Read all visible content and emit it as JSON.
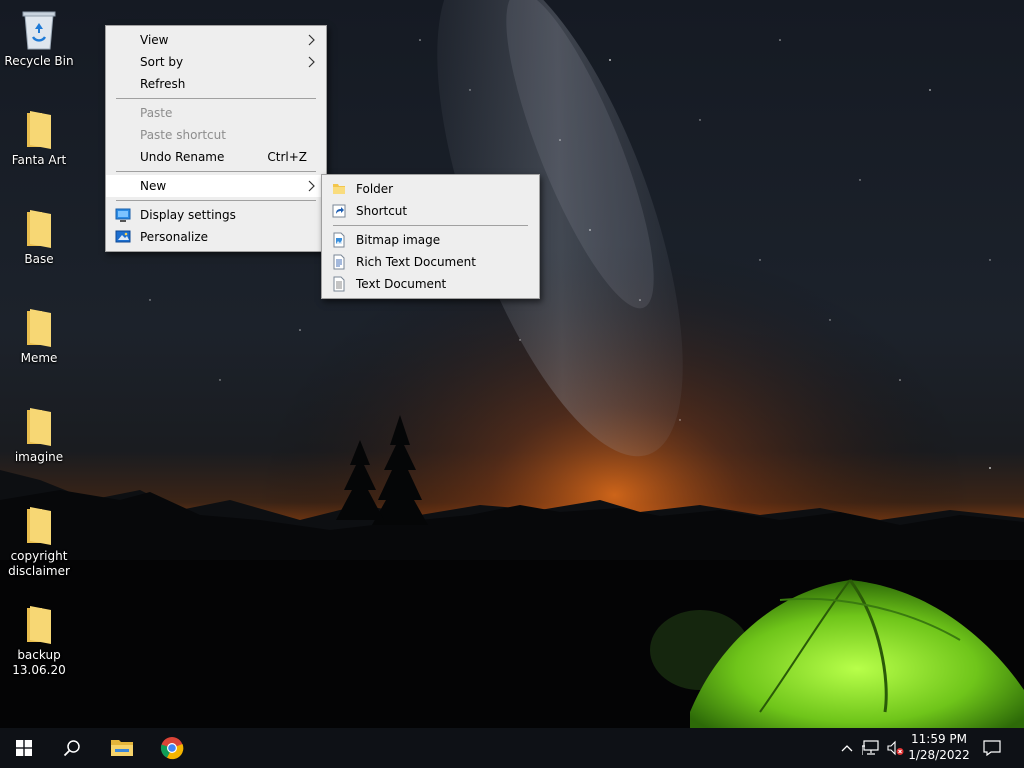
{
  "desktop": {
    "icons": [
      {
        "label": "Recycle Bin",
        "icon": "recycle-bin-icon"
      },
      {
        "label": "Fanta Art",
        "icon": "folder-icon"
      },
      {
        "label": "Base",
        "icon": "folder-icon"
      },
      {
        "label": "Meme",
        "icon": "folder-icon"
      },
      {
        "label": "imagine",
        "icon": "folder-icon"
      },
      {
        "label": "copyright disclaimer",
        "icon": "folder-icon"
      },
      {
        "label": "backup 13.06.20",
        "icon": "folder-icon"
      }
    ]
  },
  "context_menu": {
    "items": [
      {
        "label": "View",
        "has_submenu": true
      },
      {
        "label": "Sort by",
        "has_submenu": true
      },
      {
        "label": "Refresh"
      },
      {
        "label": "Paste",
        "disabled": true
      },
      {
        "label": "Paste shortcut",
        "disabled": true
      },
      {
        "label": "Undo Rename",
        "shortcut": "Ctrl+Z"
      },
      {
        "label": "New",
        "has_submenu": true,
        "highlighted": true
      },
      {
        "label": "Display settings",
        "icon": "display-settings-icon"
      },
      {
        "label": "Personalize",
        "icon": "personalize-icon"
      }
    ]
  },
  "new_submenu": {
    "items": [
      {
        "label": "Folder",
        "icon": "folder-icon"
      },
      {
        "label": "Shortcut",
        "icon": "shortcut-icon"
      },
      {
        "label": "Bitmap image",
        "icon": "bitmap-image-icon"
      },
      {
        "label": "Rich Text Document",
        "icon": "rich-text-document-icon"
      },
      {
        "label": "Text Document",
        "icon": "text-document-icon"
      }
    ]
  },
  "taskbar": {
    "pinned": [
      "start-icon",
      "search-icon",
      "file-explorer-icon",
      "chrome-icon"
    ],
    "tray": [
      "chevron-up-icon",
      "network-icon",
      "volume-muted-icon"
    ],
    "clock": {
      "time": "11:59 PM",
      "date": "1/28/2022"
    },
    "notification": "notification-icon"
  },
  "colors": {
    "menu_bg": "#eeeeee",
    "menu_highlight": "#ffffff",
    "taskbar_bg": "#0e1116",
    "folder_yellow": "#f7d774",
    "tent_green": "#7ed321"
  }
}
